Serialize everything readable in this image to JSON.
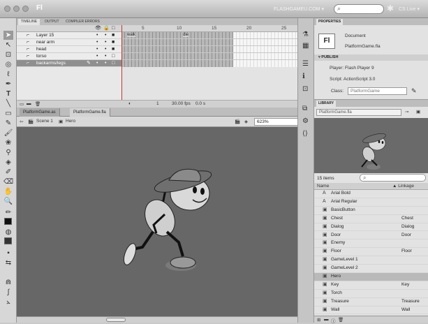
{
  "titlebar": {
    "app_logo": "Fl",
    "workspace": "FLASHGAMEU.COM ▾",
    "search_placeholder": "",
    "cslive": "CS Live ▾"
  },
  "timeline": {
    "tabs": [
      "TIMELINE",
      "OUTPUT",
      "COMPILER ERRORS"
    ],
    "ruler": [
      "5",
      "10",
      "15",
      "20",
      "25"
    ],
    "layers": [
      {
        "name": "Layer 15"
      },
      {
        "name": "near arm"
      },
      {
        "name": "head"
      },
      {
        "name": "torso"
      },
      {
        "name": "backarms/legs"
      }
    ],
    "frame_labels": [
      "walk",
      "die"
    ],
    "footer": {
      "frame": "1",
      "fps": "30.00 fps",
      "time": "0.0 s"
    }
  },
  "document_tabs": [
    "PlatformGame.as",
    "PlatformGame.fla"
  ],
  "edit_bar": {
    "scene": "Scene 1",
    "symbol": "Hero",
    "zoom": "623%"
  },
  "properties": {
    "tab": "PROPERTIES",
    "doc_label": "Document",
    "doc_name": "PlatformGame.fla",
    "publish_header": "PUBLISH",
    "player": "Player: Flash Player 9",
    "script": "Script: ActionScript 3.0",
    "class_label": "Class:",
    "class_value": "PlatformGame"
  },
  "library": {
    "tab": "LIBRARY",
    "file": "PlatformGame.fla",
    "count": "15 items",
    "col_name": "Name",
    "col_linkage": "▲ Linkage",
    "items": [
      {
        "icon": "A",
        "name": "Arial Bold",
        "linkage": ""
      },
      {
        "icon": "A",
        "name": "Arial Regular",
        "linkage": ""
      },
      {
        "icon": "▣",
        "name": "BasicButton",
        "linkage": ""
      },
      {
        "icon": "▣",
        "name": "Chest",
        "linkage": "Chest"
      },
      {
        "icon": "▣",
        "name": "Dialog",
        "linkage": "Dialog"
      },
      {
        "icon": "▣",
        "name": "Door",
        "linkage": "Door"
      },
      {
        "icon": "▣",
        "name": "Enemy",
        "linkage": ""
      },
      {
        "icon": "▣",
        "name": "Floor",
        "linkage": "Floor"
      },
      {
        "icon": "▣",
        "name": "GameLevel 1",
        "linkage": ""
      },
      {
        "icon": "▣",
        "name": "GameLevel 2",
        "linkage": ""
      },
      {
        "icon": "▣",
        "name": "Hero",
        "linkage": ""
      },
      {
        "icon": "▣",
        "name": "Key",
        "linkage": "Key"
      },
      {
        "icon": "▣",
        "name": "Torch",
        "linkage": ""
      },
      {
        "icon": "▣",
        "name": "Treasure",
        "linkage": "Treasure"
      },
      {
        "icon": "▣",
        "name": "Wall",
        "linkage": "Wall"
      }
    ]
  },
  "colors": {
    "stage": "#676767",
    "panel": "#e2e2e2",
    "selection": "#8f8f8f"
  }
}
